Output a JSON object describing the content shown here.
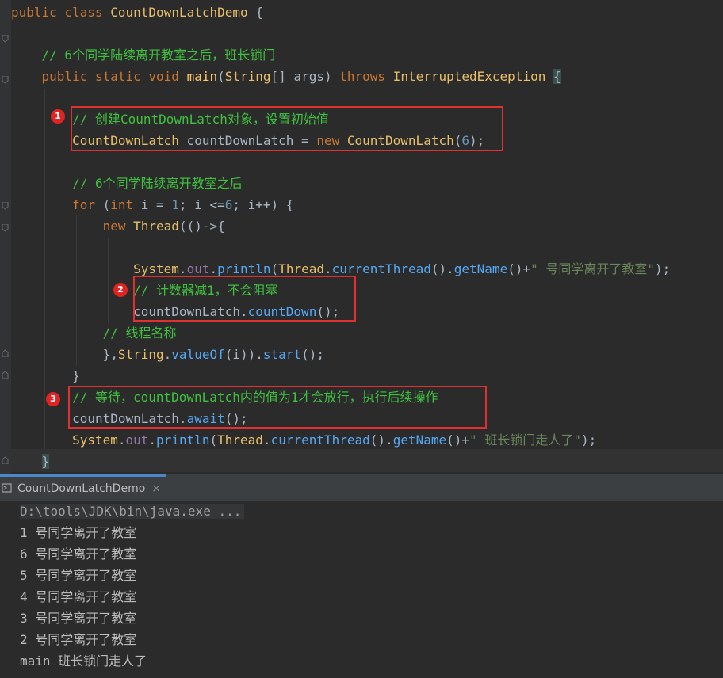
{
  "code": {
    "l1": {
      "kw1": "public",
      "kw2": "class",
      "cls": "CountDownLatchDemo",
      "rest": " {"
    },
    "l3": {
      "comment": "// 6个同学陆续离开教室之后，班长锁门"
    },
    "l4": {
      "kw1": "public",
      "kw2": "static",
      "kw3": "void",
      "fn": "main",
      "p1": "(",
      "type": "String",
      "p2": "[] ",
      "param": "args",
      "p3": ") ",
      "kw4": "throws",
      "exc": "InterruptedException",
      "brace": "{"
    },
    "l6": {
      "comment": "// 创建CountDownLatch对象，设置初始值"
    },
    "l7": {
      "type": "CountDownLatch",
      "var": " countDownLatch = ",
      "kw": "new",
      "cls": "CountDownLatch",
      "p1": "(",
      "num": "6",
      "p2": ");"
    },
    "l9": {
      "comment": "// 6个同学陆续离开教室之后"
    },
    "l10": {
      "kw": "for",
      "p1": " (",
      "kw2": "int",
      "p2": " i = ",
      "num1": "1",
      "p3": "; i <=",
      "num2": "6",
      "p4": "; i++) {"
    },
    "l11": {
      "kw": "new",
      "cls": "Thread",
      "rest": "(()->{"
    },
    "l13": {
      "cls1": "System",
      "dot1": ".",
      "fld": "out",
      "dot2": ".",
      "mth1": "println",
      "p1": "(",
      "cls2": "Thread",
      "dot3": ".",
      "mth2": "currentThread",
      "p2": "().",
      "mth3": "getName",
      "p3": "()+",
      "str": "\" 号同学离开了教室\"",
      "p4": ");"
    },
    "l14": {
      "comment": "// 计数器减1，不会阻塞"
    },
    "l15": {
      "var": "countDownLatch.",
      "mth": "countDown",
      "rest": "();"
    },
    "l16": {
      "comment": "// 线程名称"
    },
    "l17": {
      "p1": "},",
      "cls": "String",
      "dot": ".",
      "mth1": "valueOf",
      "p2": "(i)).",
      "mth2": "start",
      "p3": "();"
    },
    "l18": {
      "brace": "}"
    },
    "l19": {
      "comment": "// 等待，countDownLatch内的值为1才会放行，执行后续操作"
    },
    "l20": {
      "var": "countDownLatch.",
      "mth": "await",
      "rest": "();"
    },
    "l21": {
      "cls1": "System",
      "dot1": ".",
      "fld": "out",
      "dot2": ".",
      "mth1": "println",
      "p1": "(",
      "cls2": "Thread",
      "dot3": ".",
      "mth2": "currentThread",
      "p2": "().",
      "mth3": "getName",
      "p3": "()+",
      "str": "\" 班长锁门走人了\"",
      "p4": ");"
    },
    "l22": {
      "brace": "}"
    }
  },
  "badges": {
    "b1": "1",
    "b2": "2",
    "b3": "3"
  },
  "run_tab": {
    "label": "CountDownLatchDemo",
    "close": "×"
  },
  "console": {
    "cmd": "D:\\tools\\JDK\\bin\\java.exe ...",
    "lines": [
      "1 号同学离开了教室",
      "6 号同学离开了教室",
      "5 号同学离开了教室",
      "4 号同学离开了教室",
      "3 号同学离开了教室",
      "2 号同学离开了教室",
      "main 班长锁门走人了"
    ]
  },
  "colors": {
    "highlight_box": "#e03030",
    "badge": "#e02323",
    "comment": "#3fc13f",
    "keyword": "#cc7832",
    "tab_accent": "#4a88c7"
  }
}
